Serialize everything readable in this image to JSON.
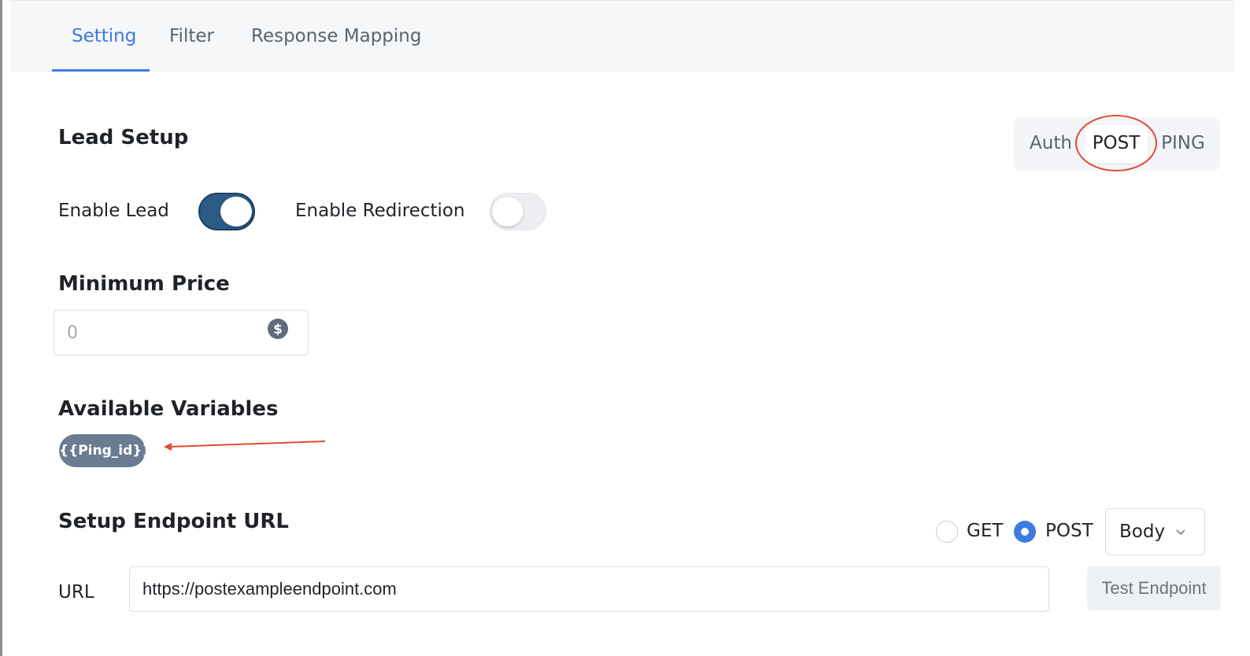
{
  "tabs": [
    {
      "label": "Setting",
      "active": true
    },
    {
      "label": "Filter",
      "active": false
    },
    {
      "label": "Response Mapping",
      "active": false
    }
  ],
  "lead_setup": {
    "title": "Lead Setup",
    "mode_selector": {
      "options": [
        "Auth",
        "POST",
        "PING"
      ],
      "selected": "POST"
    },
    "enable_lead": {
      "label": "Enable Lead",
      "on": true
    },
    "enable_redirection": {
      "label": "Enable Redirection",
      "on": false
    }
  },
  "minimum_price": {
    "title": "Minimum Price",
    "placeholder": "0",
    "value": "",
    "icon": "dollar-circle-icon"
  },
  "available_variables": {
    "title": "Available Variables",
    "chips": [
      "{{Ping_id}}"
    ]
  },
  "endpoint": {
    "title": "Setup Endpoint URL",
    "methods": [
      {
        "label": "GET",
        "selected": false
      },
      {
        "label": "POST",
        "selected": true
      }
    ],
    "body_select": {
      "value": "Body"
    },
    "url_label": "URL",
    "url_value": "https://postexampleendpoint.com",
    "test_button": "Test Endpoint"
  },
  "colors": {
    "accent": "#3d7be0",
    "toggle_on": "#2b5c86",
    "annotation": "#e14a33",
    "chip": "#6b7c92"
  }
}
